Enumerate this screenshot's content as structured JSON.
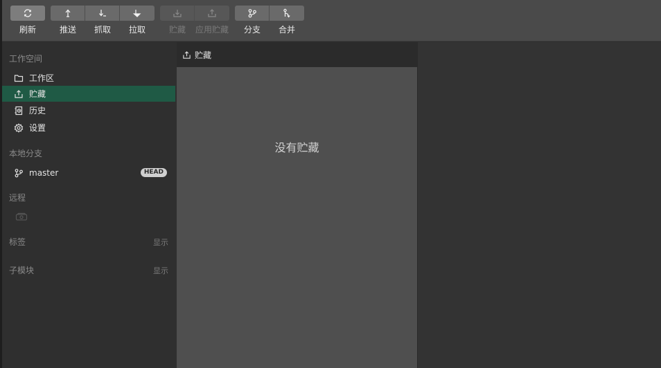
{
  "toolbar": {
    "groups": [
      {
        "buttons": [
          {
            "icon": "refresh-icon",
            "label": "刷新",
            "enabled": true
          }
        ]
      },
      {
        "buttons": [
          {
            "icon": "push-icon",
            "label": "推送",
            "enabled": true
          },
          {
            "icon": "fetch-icon",
            "label": "抓取",
            "enabled": true
          },
          {
            "icon": "pull-icon",
            "label": "拉取",
            "enabled": true
          }
        ]
      },
      {
        "buttons": [
          {
            "icon": "stash-icon",
            "label": "贮藏",
            "enabled": false
          },
          {
            "icon": "apply-stash-icon",
            "label": "应用贮藏",
            "enabled": false
          }
        ]
      },
      {
        "buttons": [
          {
            "icon": "branch-icon",
            "label": "分支",
            "enabled": true
          },
          {
            "icon": "merge-icon",
            "label": "合并",
            "enabled": true
          }
        ]
      }
    ]
  },
  "sidebar": {
    "workspace": {
      "title": "工作空间",
      "items": [
        {
          "icon": "folder-icon",
          "label": "工作区",
          "selected": false
        },
        {
          "icon": "stash-icon",
          "label": "贮藏",
          "selected": true
        },
        {
          "icon": "history-icon",
          "label": "历史",
          "selected": false
        },
        {
          "icon": "gear-icon",
          "label": "设置",
          "selected": false
        }
      ]
    },
    "local_branches": {
      "title": "本地分支",
      "items": [
        {
          "icon": "branch-icon",
          "label": "master",
          "badge": "HEAD"
        }
      ]
    },
    "remotes": {
      "title": "远程",
      "icon": "remote-icon"
    },
    "tags": {
      "title": "标签",
      "action": "显示"
    },
    "submodules": {
      "title": "子模块",
      "action": "显示"
    }
  },
  "main": {
    "header": {
      "icon": "stash-icon",
      "title": "贮藏"
    },
    "empty_message": "没有贮藏"
  },
  "colors": {
    "selected_bg": "#1f5a45",
    "toolbar_bg": "#4a4a4a",
    "pane_bg": "#4f4f4f"
  }
}
